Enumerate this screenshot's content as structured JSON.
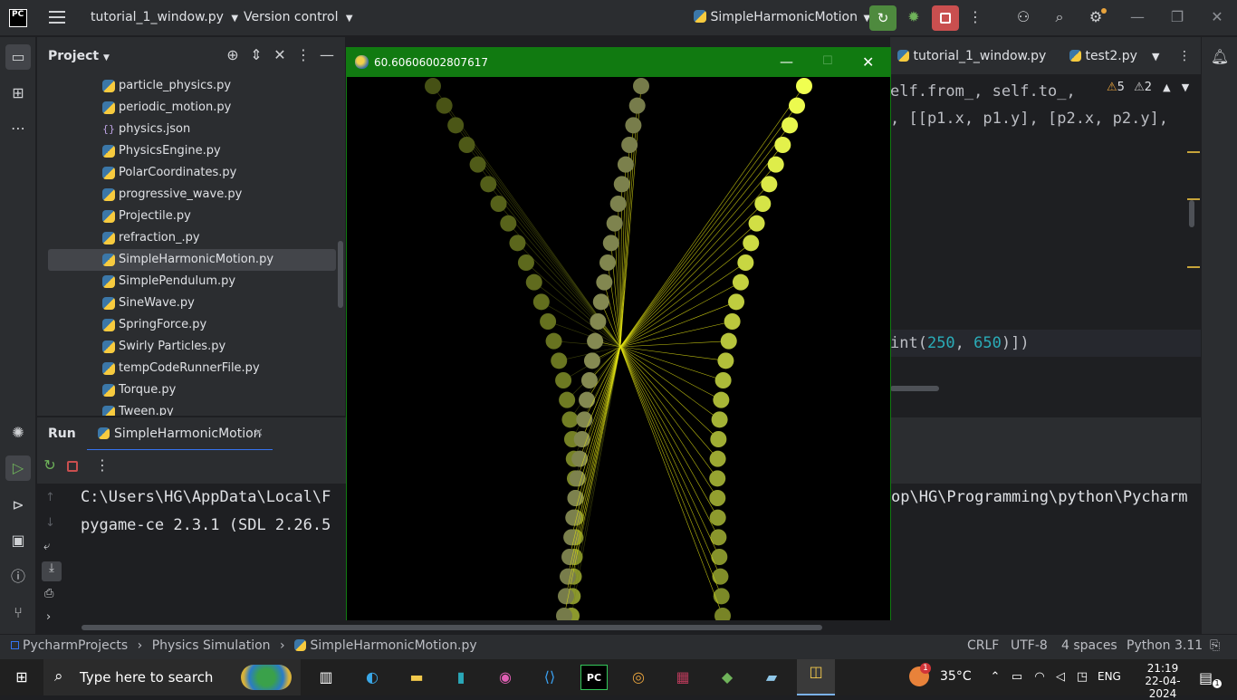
{
  "titlebar": {
    "logo_text": "PC",
    "file_name": "tutorial_1_window.py",
    "version_control": "Version control",
    "run_config": "SimpleHarmonicMotion"
  },
  "project": {
    "title": "Project",
    "files": [
      {
        "name": "particle_physics.py",
        "type": "py"
      },
      {
        "name": "periodic_motion.py",
        "type": "py"
      },
      {
        "name": "physics.json",
        "type": "json"
      },
      {
        "name": "PhysicsEngine.py",
        "type": "py"
      },
      {
        "name": "PolarCoordinates.py",
        "type": "py"
      },
      {
        "name": "progressive_wave.py",
        "type": "py"
      },
      {
        "name": "Projectile.py",
        "type": "py"
      },
      {
        "name": "refraction_.py",
        "type": "py"
      },
      {
        "name": "SimpleHarmonicMotion.py",
        "type": "py",
        "selected": true
      },
      {
        "name": "SimplePendulum.py",
        "type": "py"
      },
      {
        "name": "SineWave.py",
        "type": "py"
      },
      {
        "name": "SpringForce.py",
        "type": "py"
      },
      {
        "name": "Swirly Particles.py",
        "type": "py"
      },
      {
        "name": "tempCodeRunnerFile.py",
        "type": "py"
      },
      {
        "name": "Torque.py",
        "type": "py"
      },
      {
        "name": "Tween.py",
        "type": "py"
      }
    ]
  },
  "editor": {
    "tabs": [
      "tutorial_1_window.py",
      "test2.py"
    ],
    "warnings": "5",
    "weak_warnings": "2",
    "line1": "elf.from_, self.to_,",
    "line2": ", [[p1.x, p1.y], [p2.x, p2.y],",
    "line3_prefix": "int(",
    "line3_num1": "250",
    "line3_sep": ", ",
    "line3_num2": "650",
    "line3_suffix": ")])"
  },
  "run": {
    "label": "Run",
    "tab": "SimpleHarmonicMotion",
    "console": [
      "C:\\Users\\HG\\AppData\\Local\\F",
      "pygame-ce 2.3.1 (SDL 2.26.5"
    ],
    "console_right": "op\\HG\\Programming\\python\\Pycharm"
  },
  "pygame_window": {
    "title": "60.60606002807617"
  },
  "statusbar": {
    "breadcrumb": [
      "PycharmProjects",
      "Physics Simulation",
      "SimpleHarmonicMotion.py"
    ],
    "line_ending": "CRLF",
    "encoding": "UTF-8",
    "indent": "4 spaces",
    "interpreter": "Python 3.11"
  },
  "taskbar": {
    "search_placeholder": "Type here to search",
    "temperature": "35°C",
    "language": "ENG",
    "time": "21:19",
    "date": "22-04-2024",
    "notif_count": "1",
    "weather_badge": "1"
  }
}
